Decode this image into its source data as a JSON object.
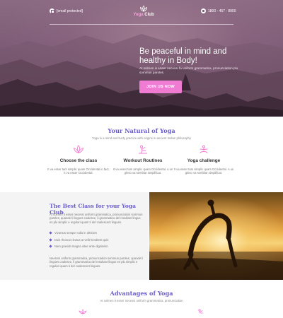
{
  "header": {
    "email": "[email protected]",
    "logo_prefix": "Yoga",
    "logo_suffix": "Club",
    "phone": "1800 - 457 - 8900"
  },
  "hero": {
    "title": "Be peaceful in mind and healthy in Body!",
    "subtitle": "At solmen ix enser necessi fa uniform grammatica, pronunciation plu sommun paroles.",
    "button_label": "JOIN US NOW"
  },
  "natural": {
    "title": "Your Natural of Yoga",
    "subtitle": "Yoga is a mind and body practice with origins in ancient Indian philosophy",
    "features": [
      {
        "icon": "lotus-icon",
        "title": "Choose the class",
        "text": "It va esser tam simplic quam Occidental in fact, it va esser Occidental."
      },
      {
        "icon": "stretch-icon",
        "title": "Workout Routines",
        "text": "It va esser tam simplic quam Occidental. A un gleso va semblar simplificat."
      },
      {
        "icon": "meditation-icon",
        "title": "Yoga challenge",
        "text": "It va esser tam simplic quam Occidental. A un gleso va semblar simplificat."
      }
    ]
  },
  "best": {
    "title": "The Best Class for your Yoga Club",
    "intro": "At solmen it esser necessi uniform grammatica, pronunciation sommun paroles, quande li lingues coalesce, li grammatica del resultant lingue es plu simplic e regulari quam ti del coalescent lingues.",
    "list": [
      "Vivamus semper odio in ultricies",
      "Duis rhoncus lectus at velit hendrerit quis",
      "Nam gravida magna vitae ante dignissim"
    ],
    "outro": "Neesesi uniform grammatica, pronunciation sommun paroles, quande li lingues coalesce, li grammatica del resultant lingue es plu simplic e regulari quam ti del coalescent lingues."
  },
  "advantages": {
    "title": "Advantages of Yoga",
    "subtitle": "At solmen it esser necessi uniform grammatica, pronunciation"
  },
  "colors": {
    "accent_purple": "#6a5ccd",
    "accent_pink": "#f07bd3"
  }
}
